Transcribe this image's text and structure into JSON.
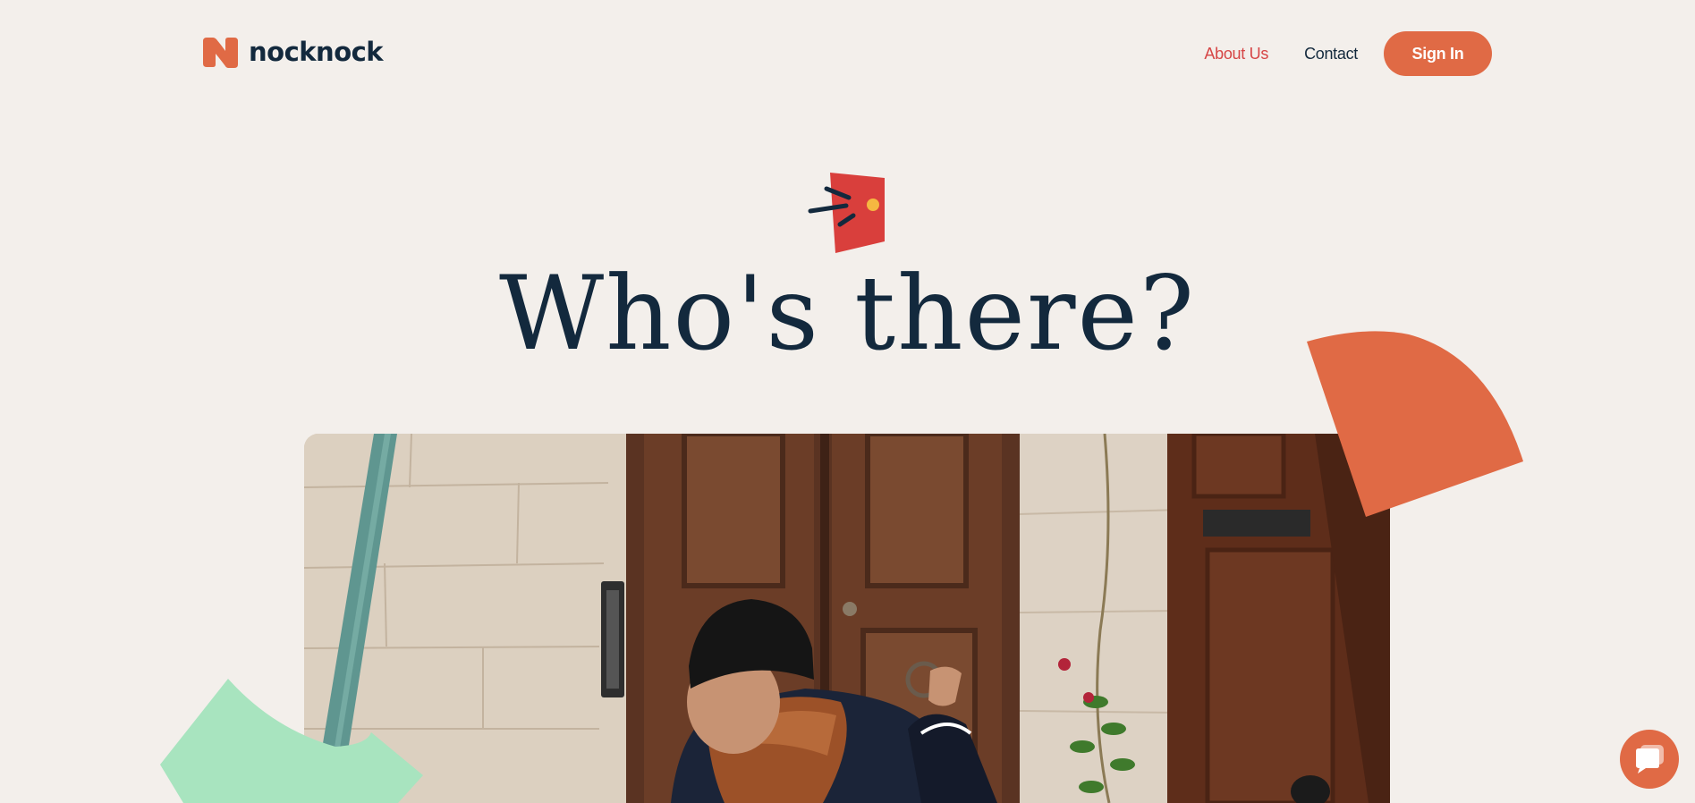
{
  "header": {
    "logo_text": "nocknock",
    "nav": {
      "about_label": "About Us",
      "contact_label": "Contact",
      "signin_label": "Sign In"
    }
  },
  "hero": {
    "title": "Who's there?",
    "icon": "door-knock-icon"
  },
  "photo": {
    "subject": "person knocking on wooden door"
  },
  "chat": {
    "icon": "chat-bubble-icon"
  },
  "colors": {
    "background": "#f3efeb",
    "navy": "#13293d",
    "accent_orange": "#e06a45",
    "accent_red": "#d64545",
    "mint": "#a8e4bf"
  }
}
